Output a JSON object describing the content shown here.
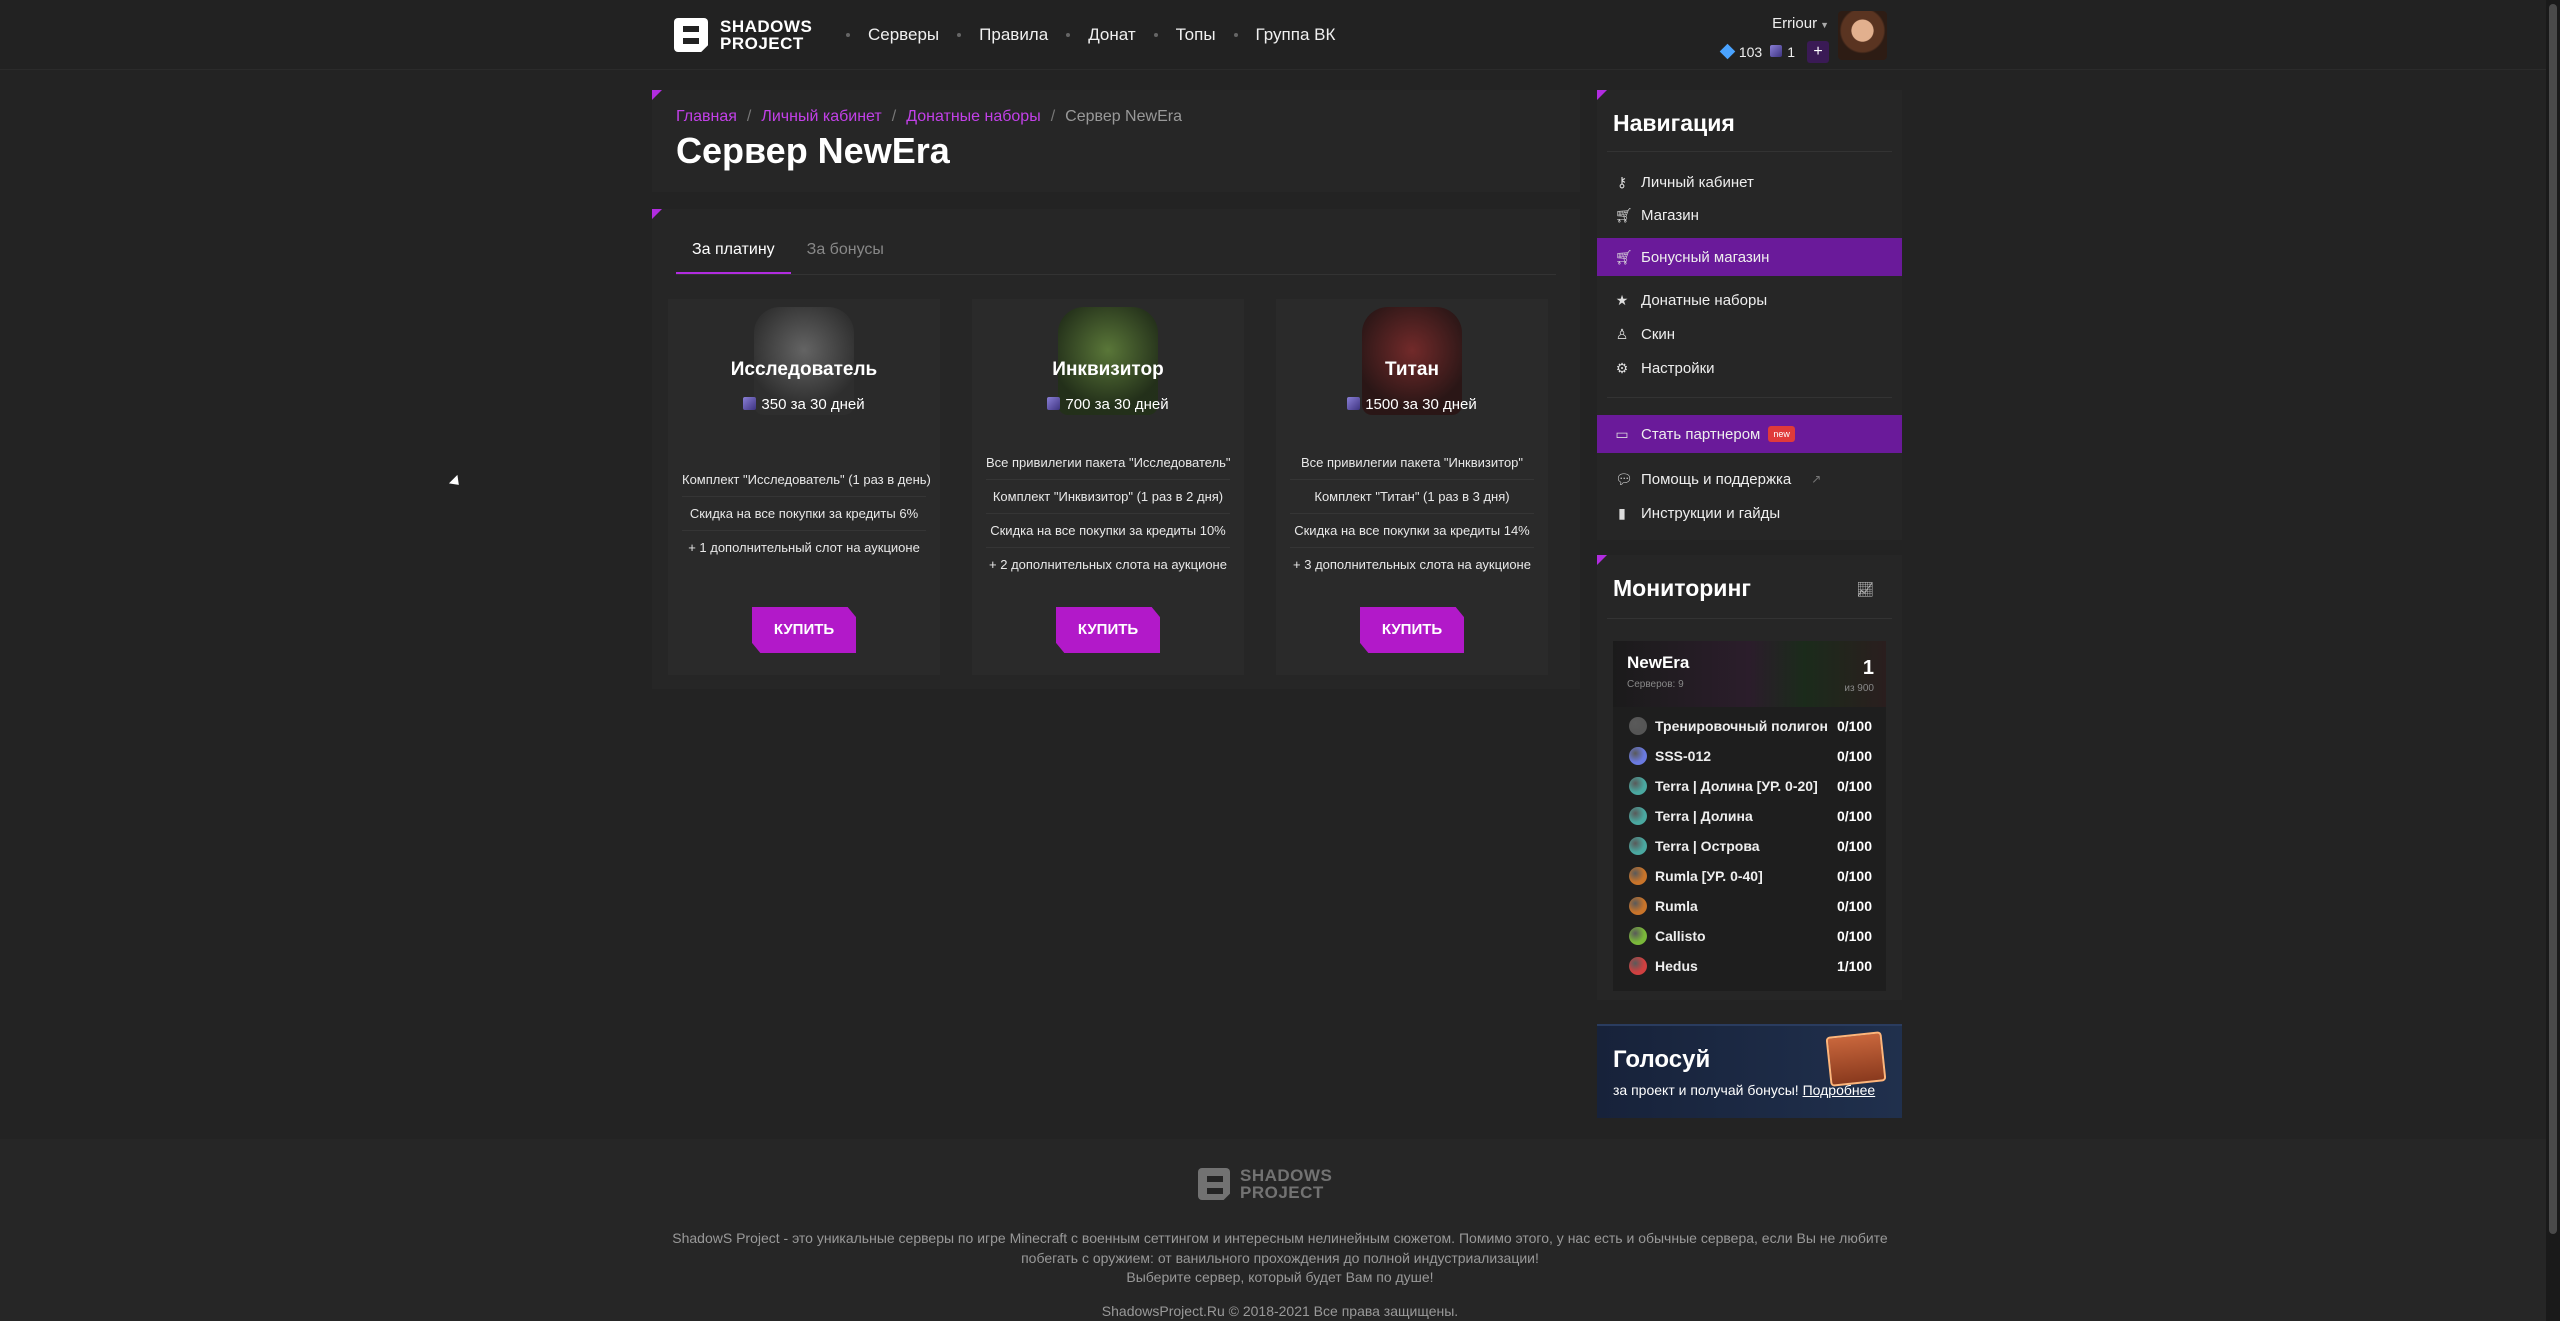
{
  "brand": {
    "line1": "SHADOWS",
    "line2": "PROJECT"
  },
  "nav": [
    "Серверы",
    "Правила",
    "Донат",
    "Топы",
    "Группа ВК"
  ],
  "user": {
    "name": "Erriour",
    "gems": "103",
    "platinum": "1",
    "plus": "+"
  },
  "breadcrumb": [
    "Главная",
    "Личный кабинет",
    "Донатные наборы"
  ],
  "breadcrumb_sep": "/",
  "breadcrumb_current": "Сервер NewEra",
  "page_title": "Сервер NewEra",
  "tabs": [
    "За платину",
    "За бонусы"
  ],
  "packages": [
    {
      "name": "Исследователь",
      "price": "350 за 30 дней",
      "features": [
        "Комплект \"Исследователь\" (1 раз в день)",
        "Скидка на все покупки за кредиты 6%",
        "+ 1 дополнительный слот на аукционе"
      ],
      "buy": "КУПИТЬ",
      "color": "#5a5a5a"
    },
    {
      "name": "Инквизитор",
      "price": "700 за 30 дней",
      "features": [
        "Все привилегии пакета \"Исследователь\"",
        "Комплект \"Инквизитор\" (1 раз в 2 дня)",
        "Скидка на все покупки за кредиты 10%",
        "+ 2 дополнительных слота на аукционе"
      ],
      "buy": "КУПИТЬ",
      "color": "#3f5a32"
    },
    {
      "name": "Титан",
      "price": "1500 за 30 дней",
      "features": [
        "Все привилегии пакета \"Инквизитор\"",
        "Комплект \"Титан\" (1 раз в 3 дня)",
        "Скидка на все покупки за кредиты 14%",
        "+ 3 дополнительных слота на аукционе"
      ],
      "buy": "КУПИТЬ",
      "color": "#5a2a2a"
    }
  ],
  "sidebar": {
    "title": "Навигация",
    "items": [
      "Личный кабинет",
      "Магазин",
      "Бонусный магазин",
      "Донатные наборы",
      "Скин",
      "Настройки"
    ],
    "partner": "Стать партнером",
    "partner_badge": "new",
    "help": "Помощь и поддержка",
    "guides": "Инструкции и гайды"
  },
  "monitoring": {
    "title": "Мониторинг",
    "server": "NewEra",
    "servers_count": "Серверов: 9",
    "online": "1",
    "max": "из 900",
    "list": [
      {
        "name": "Тренировочный полигон",
        "value": "0/100",
        "color": "#555555"
      },
      {
        "name": "SSS-012",
        "value": "0/100",
        "color": "#6a7ae0"
      },
      {
        "name": "Terra | Долина [УР. 0-20]",
        "value": "0/100",
        "color": "#4aa8a0"
      },
      {
        "name": "Terra | Долина",
        "value": "0/100",
        "color": "#4aa8a0"
      },
      {
        "name": "Terra | Острова",
        "value": "0/100",
        "color": "#4aa8a0"
      },
      {
        "name": "Rumla [УР. 0-40]",
        "value": "0/100",
        "color": "#c8742a"
      },
      {
        "name": "Rumla",
        "value": "0/100",
        "color": "#c8742a"
      },
      {
        "name": "Callisto",
        "value": "0/100",
        "color": "#7ab83a"
      },
      {
        "name": "Hedus",
        "value": "1/100",
        "color": "#d04040"
      }
    ]
  },
  "vote": {
    "title": "Голосуй",
    "text": "за проект и получай бонусы!",
    "link": "Подробнее"
  },
  "footer": {
    "line1": "ShadowS Project - это уникальные серверы по игре Minecraft с военным сеттингом и интересным нелинейным сюжетом. Помимо этого, у нас есть и обычные сервера, если Вы не любите",
    "line2": "побегать с оружием: от ванильного прохождения до полной индустриализации!",
    "line3": "Выберите сервер, который будет Вам по душе!",
    "copyright": "ShadowsProject.Ru © 2018-2021 Все права защищены."
  }
}
